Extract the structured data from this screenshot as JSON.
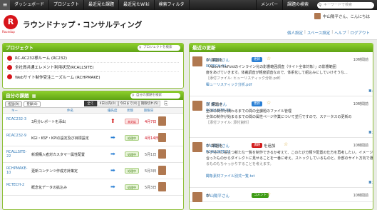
{
  "topbar": {
    "nav": [
      "ダッシュボード",
      "プロジェクト",
      "最近見た課題",
      "最近見たWiki",
      "検索フィルタ"
    ],
    "right": [
      "メンバー",
      "課題の検索"
    ],
    "search_placeholder": "キーワードで検索"
  },
  "header": {
    "title": "ラウンドナップ・コンサルティング",
    "logo_text": "Roundup",
    "greeting": "中山陽平さん、こんにちは",
    "links": [
      "個人設定",
      "スペース設定",
      "ヘルプ",
      "ログアウト"
    ]
  },
  "projects": {
    "heading": "プロジェクト",
    "search_placeholder": "プロジェクトを検索",
    "items": [
      "RC-AC232様ルーム (RC232)",
      "全社員共通エレメント利用状況(RCALLSITE)",
      "Webサイト制作受注ニーズルーム (RCHPMAKE)"
    ]
  },
  "my_issues": {
    "heading": "自分の課題",
    "search_placeholder": "自分の課題を検索",
    "tabs": [
      "担当(9)",
      "登録(8)"
    ],
    "filters": [
      "全て",
      "4日以内(0)",
      "今日まで(0)",
      "期限切れ(5)"
    ],
    "columns": [
      "キー",
      "件名",
      "優先度",
      "状態",
      "期限日"
    ],
    "rows": [
      {
        "key": "RCAC232-3",
        "title": "3月分レポートを添出",
        "prio": "up",
        "status": "未対応",
        "status_color": "red",
        "due": "4月7日",
        "due_late": true
      },
      {
        "key": "RCAC232-9",
        "title": "KGI・KSF・KPIの設定及び目標設定",
        "prio": "right",
        "status": "処理中",
        "status_color": "green",
        "due": "4月14日",
        "due_late": true
      },
      {
        "key": "RCALLSITE-22",
        "title": "新規購入者対カスタマー属性配置",
        "prio": "right",
        "status": "処理中",
        "status_color": "green",
        "due": "5月1日",
        "due_late": false
      },
      {
        "key": "RCHPMAKE-10",
        "title": "更新コンテンツ作成方針策定",
        "prio": "right",
        "status": "処理中",
        "status_color": "green",
        "due": "5月3日",
        "due_late": false
      },
      {
        "key": "RCTECH-2",
        "title": "概念化データの拡込み",
        "prio": "right",
        "status": "処理中",
        "status_color": "green",
        "due": "5月3日",
        "due_late": false
      }
    ]
  },
  "activity": {
    "heading": "最近の更新",
    "items": [
      {
        "user": "中山陽平さん",
        "action": "が 課題を",
        "badge": "更新",
        "badge_color": "blue",
        "time": "10時間前",
        "line1_key": "RCTECH-04",
        "line1": "「AboveTheFoldのインライン化の影響範囲調査（サイト全体対象）」の影響範囲",
        "line2": "度をあげていきます。体裁調査が軽度調査なので、体系化して組込みにしていけそうな...",
        "line3": "［添付ファイル: ヒューリスティック分析.pdf］",
        "file": "ヒューリスティック分析.pdf",
        "comment": "コメントする"
      },
      {
        "user": "嶺 健二さん",
        "action": "が 課題を",
        "badge": "更新",
        "badge_color": "blue",
        "time": "10時間前",
        "line1_key": "RCALLSITE-24",
        "line1": "全体の制作が関わるまでの間の全課題のファイル管理",
        "line2": "全体の制作が始まるまでの間の属性ページ作業について並行ですので、ステータスの更新の",
        "line3": "［添付ファイル: 添付資料］",
        "file": "",
        "comment": "コメントする"
      },
      {
        "user": "中山陽平さん",
        "action": "が 課題を",
        "badge": "課題",
        "badge_color": "red",
        "action2": "を追加",
        "time": "10時間前",
        "line1_key": "RCALLSITE-21",
        "line1": "タグ付けに役立つ新たな一覧を制作できるか考えて、このたび分類や配置の仕方を再考したい。イメージに",
        "line2": "合ったものからダイレクトに見せることを一番に考え、ストックしているものと、外部のサイト方向で選べられ",
        "line3": "るものもちゃっかりすることを考えます。",
        "file": "対象素材ファイル別式一覧.txt",
        "comment": "コメントする"
      },
      {
        "user": "中山陽平さん",
        "action": "が",
        "badge": "コメント",
        "badge_color": "green",
        "time": "10時間前",
        "line1_key": "",
        "line1": "",
        "line2": "",
        "line3": "",
        "file": "",
        "comment": ""
      }
    ]
  },
  "colors": {
    "brand_red": "#d7141a",
    "panel_green": "#6fb51e",
    "link_blue": "#337ab7"
  }
}
